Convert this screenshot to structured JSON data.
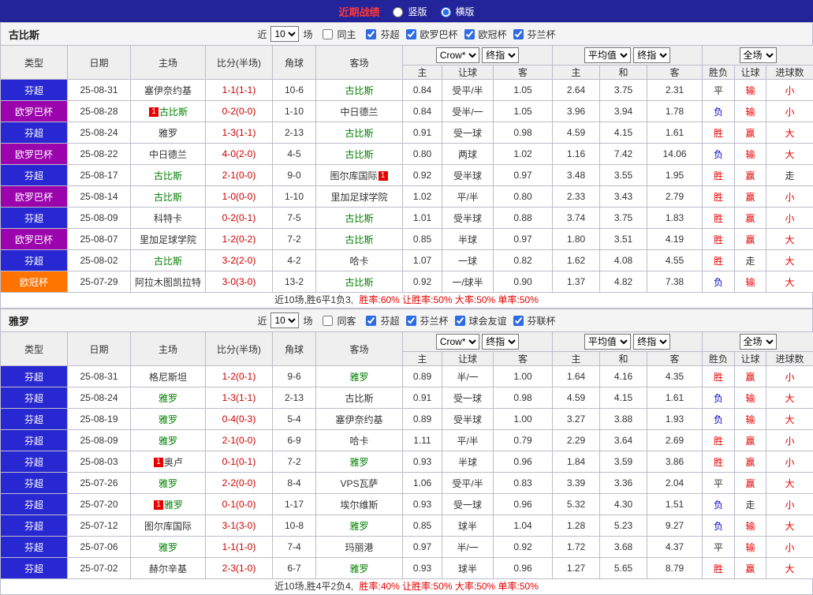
{
  "colors": {
    "topbar_bg": "#23239a",
    "title_red": "#ff3838",
    "league_blue": "#2828d2",
    "league_purple": "#9b03ac",
    "league_orange": "#ff7300",
    "focus_team_green": "#008000",
    "score_red": "#cc0000",
    "result_red": "#e60000",
    "result_blue": "#0000cc",
    "result_black": "#333333"
  },
  "top_bar": {
    "title": "近期战绩",
    "options": [
      {
        "label": "竖版",
        "selected": false
      },
      {
        "label": "横版",
        "selected": true
      }
    ]
  },
  "table_header": {
    "type": "类型",
    "date": "日期",
    "home": "主场",
    "score": "比分(半场)",
    "corner": "角球",
    "away": "客场",
    "crow_select": "Crow*",
    "final_select": "终指",
    "avg_select": "平均值",
    "fullmatch_select": "全场",
    "odds_home": "主",
    "odds_handicap": "让球",
    "odds_away": "客",
    "avg_home": "主",
    "avg_draw": "和",
    "avg_away": "客",
    "result_wdl": "胜负",
    "result_handicap": "让球",
    "result_goals": "进球数"
  },
  "sections": [
    {
      "team": "古比斯",
      "filters": {
        "near": "近",
        "count": "10",
        "games": "场",
        "same_side": "同主",
        "leagues": [
          "芬超",
          "欧罗巴杯",
          "欧冠杯",
          "芬兰杯"
        ]
      },
      "rows": [
        {
          "type": "芬超",
          "tc": "blue",
          "date": "25-08-31",
          "home": {
            "name": "塞伊奈约基",
            "focus": false
          },
          "score": "1-1(1-1)",
          "corner": "10-6",
          "away": {
            "name": "古比斯",
            "focus": true
          },
          "odds": [
            "0.84",
            "受平/半",
            "1.05"
          ],
          "avg": [
            "2.64",
            "3.75",
            "2.31"
          ],
          "res": [
            {
              "t": "平",
              "c": "black"
            },
            {
              "t": "输",
              "c": "red"
            },
            {
              "t": "小",
              "c": "red"
            }
          ]
        },
        {
          "type": "欧罗巴杯",
          "tc": "purple",
          "date": "25-08-28",
          "home": {
            "name": "古比斯",
            "focus": true,
            "badge_before": "1"
          },
          "score": "0-2(0-0)",
          "corner": "1-10",
          "away": {
            "name": "中日德兰",
            "focus": false
          },
          "odds": [
            "0.84",
            "受半/一",
            "1.05"
          ],
          "avg": [
            "3.96",
            "3.94",
            "1.78"
          ],
          "res": [
            {
              "t": "负",
              "c": "blue"
            },
            {
              "t": "输",
              "c": "red"
            },
            {
              "t": "小",
              "c": "red"
            }
          ]
        },
        {
          "type": "芬超",
          "tc": "blue",
          "date": "25-08-24",
          "home": {
            "name": "雅罗",
            "focus": false
          },
          "score": "1-3(1-1)",
          "corner": "2-13",
          "away": {
            "name": "古比斯",
            "focus": true
          },
          "odds": [
            "0.91",
            "受一球",
            "0.98"
          ],
          "avg": [
            "4.59",
            "4.15",
            "1.61"
          ],
          "res": [
            {
              "t": "胜",
              "c": "red"
            },
            {
              "t": "赢",
              "c": "red"
            },
            {
              "t": "大",
              "c": "red"
            }
          ]
        },
        {
          "type": "欧罗巴杯",
          "tc": "purple",
          "date": "25-08-22",
          "home": {
            "name": "中日德兰",
            "focus": false
          },
          "score": "4-0(2-0)",
          "corner": "4-5",
          "away": {
            "name": "古比斯",
            "focus": true
          },
          "odds": [
            "0.80",
            "两球",
            "1.02"
          ],
          "avg": [
            "1.16",
            "7.42",
            "14.06"
          ],
          "res": [
            {
              "t": "负",
              "c": "blue"
            },
            {
              "t": "输",
              "c": "red"
            },
            {
              "t": "大",
              "c": "red"
            }
          ]
        },
        {
          "type": "芬超",
          "tc": "blue",
          "date": "25-08-17",
          "home": {
            "name": "古比斯",
            "focus": true
          },
          "score": "2-1(0-0)",
          "corner": "9-0",
          "away": {
            "name": "图尔库国际",
            "focus": false,
            "badge_after": "1"
          },
          "odds": [
            "0.92",
            "受半球",
            "0.97"
          ],
          "avg": [
            "3.48",
            "3.55",
            "1.95"
          ],
          "res": [
            {
              "t": "胜",
              "c": "red"
            },
            {
              "t": "赢",
              "c": "red"
            },
            {
              "t": "走",
              "c": "black"
            }
          ]
        },
        {
          "type": "欧罗巴杯",
          "tc": "purple",
          "date": "25-08-14",
          "home": {
            "name": "古比斯",
            "focus": true
          },
          "score": "1-0(0-0)",
          "corner": "1-10",
          "away": {
            "name": "里加足球学院",
            "focus": false
          },
          "odds": [
            "1.02",
            "平/半",
            "0.80"
          ],
          "avg": [
            "2.33",
            "3.43",
            "2.79"
          ],
          "res": [
            {
              "t": "胜",
              "c": "red"
            },
            {
              "t": "赢",
              "c": "red"
            },
            {
              "t": "小",
              "c": "red"
            }
          ]
        },
        {
          "type": "芬超",
          "tc": "blue",
          "date": "25-08-09",
          "home": {
            "name": "科特卡",
            "focus": false
          },
          "score": "0-2(0-1)",
          "corner": "7-5",
          "away": {
            "name": "古比斯",
            "focus": true
          },
          "odds": [
            "1.01",
            "受半球",
            "0.88"
          ],
          "avg": [
            "3.74",
            "3.75",
            "1.83"
          ],
          "res": [
            {
              "t": "胜",
              "c": "red"
            },
            {
              "t": "赢",
              "c": "red"
            },
            {
              "t": "小",
              "c": "red"
            }
          ]
        },
        {
          "type": "欧罗巴杯",
          "tc": "purple",
          "date": "25-08-07",
          "home": {
            "name": "里加足球学院",
            "focus": false
          },
          "score": "1-2(0-2)",
          "corner": "7-2",
          "away": {
            "name": "古比斯",
            "focus": true
          },
          "odds": [
            "0.85",
            "半球",
            "0.97"
          ],
          "avg": [
            "1.80",
            "3.51",
            "4.19"
          ],
          "res": [
            {
              "t": "胜",
              "c": "red"
            },
            {
              "t": "赢",
              "c": "red"
            },
            {
              "t": "大",
              "c": "red"
            }
          ]
        },
        {
          "type": "芬超",
          "tc": "blue",
          "date": "25-08-02",
          "home": {
            "name": "古比斯",
            "focus": true
          },
          "score": "3-2(2-0)",
          "corner": "4-2",
          "away": {
            "name": "哈卡",
            "focus": false
          },
          "odds": [
            "1.07",
            "一球",
            "0.82"
          ],
          "avg": [
            "1.62",
            "4.08",
            "4.55"
          ],
          "res": [
            {
              "t": "胜",
              "c": "red"
            },
            {
              "t": "走",
              "c": "black"
            },
            {
              "t": "大",
              "c": "red"
            }
          ]
        },
        {
          "type": "欧冠杯",
          "tc": "orange",
          "date": "25-07-29",
          "home": {
            "name": "阿拉木图凯拉特",
            "focus": false
          },
          "score": "3-0(3-0)",
          "corner": "13-2",
          "away": {
            "name": "古比斯",
            "focus": true
          },
          "odds": [
            "0.92",
            "一/球半",
            "0.90"
          ],
          "avg": [
            "1.37",
            "4.82",
            "7.38"
          ],
          "res": [
            {
              "t": "负",
              "c": "blue"
            },
            {
              "t": "输",
              "c": "red"
            },
            {
              "t": "大",
              "c": "red"
            }
          ]
        }
      ],
      "summary": {
        "record": "近10场,胜6平1负3,",
        "rates": "胜率:60% 让胜率:50% 大率:50% 单率:50%"
      }
    },
    {
      "team": "雅罗",
      "filters": {
        "near": "近",
        "count": "10",
        "games": "场",
        "same_side": "同客",
        "leagues": [
          "芬超",
          "芬兰杯",
          "球会友谊",
          "芬联杯"
        ]
      },
      "rows": [
        {
          "type": "芬超",
          "tc": "blue",
          "date": "25-08-31",
          "home": {
            "name": "格尼斯坦",
            "focus": false
          },
          "score": "1-2(0-1)",
          "corner": "9-6",
          "away": {
            "name": "雅罗",
            "focus": true
          },
          "odds": [
            "0.89",
            "半/一",
            "1.00"
          ],
          "avg": [
            "1.64",
            "4.16",
            "4.35"
          ],
          "res": [
            {
              "t": "胜",
              "c": "red"
            },
            {
              "t": "赢",
              "c": "red"
            },
            {
              "t": "小",
              "c": "red"
            }
          ]
        },
        {
          "type": "芬超",
          "tc": "blue",
          "date": "25-08-24",
          "home": {
            "name": "雅罗",
            "focus": true
          },
          "score": "1-3(1-1)",
          "corner": "2-13",
          "away": {
            "name": "古比斯",
            "focus": false
          },
          "odds": [
            "0.91",
            "受一球",
            "0.98"
          ],
          "avg": [
            "4.59",
            "4.15",
            "1.61"
          ],
          "res": [
            {
              "t": "负",
              "c": "blue"
            },
            {
              "t": "输",
              "c": "red"
            },
            {
              "t": "大",
              "c": "red"
            }
          ]
        },
        {
          "type": "芬超",
          "tc": "blue",
          "date": "25-08-19",
          "home": {
            "name": "雅罗",
            "focus": true
          },
          "score": "0-4(0-3)",
          "corner": "5-4",
          "away": {
            "name": "塞伊奈约基",
            "focus": false
          },
          "odds": [
            "0.89",
            "受半球",
            "1.00"
          ],
          "avg": [
            "3.27",
            "3.88",
            "1.93"
          ],
          "res": [
            {
              "t": "负",
              "c": "blue"
            },
            {
              "t": "输",
              "c": "red"
            },
            {
              "t": "大",
              "c": "red"
            }
          ]
        },
        {
          "type": "芬超",
          "tc": "blue",
          "date": "25-08-09",
          "home": {
            "name": "雅罗",
            "focus": true
          },
          "score": "2-1(0-0)",
          "corner": "6-9",
          "away": {
            "name": "哈卡",
            "focus": false
          },
          "odds": [
            "1.11",
            "平/半",
            "0.79"
          ],
          "avg": [
            "2.29",
            "3.64",
            "2.69"
          ],
          "res": [
            {
              "t": "胜",
              "c": "red"
            },
            {
              "t": "赢",
              "c": "red"
            },
            {
              "t": "小",
              "c": "red"
            }
          ]
        },
        {
          "type": "芬超",
          "tc": "blue",
          "date": "25-08-03",
          "home": {
            "name": "奥卢",
            "focus": false,
            "badge_before": "1"
          },
          "score": "0-1(0-1)",
          "corner": "7-2",
          "away": {
            "name": "雅罗",
            "focus": true
          },
          "odds": [
            "0.93",
            "半球",
            "0.96"
          ],
          "avg": [
            "1.84",
            "3.59",
            "3.86"
          ],
          "res": [
            {
              "t": "胜",
              "c": "red"
            },
            {
              "t": "赢",
              "c": "red"
            },
            {
              "t": "小",
              "c": "red"
            }
          ]
        },
        {
          "type": "芬超",
          "tc": "blue",
          "date": "25-07-26",
          "home": {
            "name": "雅罗",
            "focus": true
          },
          "score": "2-2(0-0)",
          "corner": "8-4",
          "away": {
            "name": "VPS瓦萨",
            "focus": false
          },
          "odds": [
            "1.06",
            "受平/半",
            "0.83"
          ],
          "avg": [
            "3.39",
            "3.36",
            "2.04"
          ],
          "res": [
            {
              "t": "平",
              "c": "black"
            },
            {
              "t": "赢",
              "c": "red"
            },
            {
              "t": "大",
              "c": "red"
            }
          ]
        },
        {
          "type": "芬超",
          "tc": "blue",
          "date": "25-07-20",
          "home": {
            "name": "雅罗",
            "focus": true,
            "badge_before": "1"
          },
          "score": "0-1(0-0)",
          "corner": "1-17",
          "away": {
            "name": "埃尔维斯",
            "focus": false
          },
          "odds": [
            "0.93",
            "受一球",
            "0.96"
          ],
          "avg": [
            "5.32",
            "4.30",
            "1.51"
          ],
          "res": [
            {
              "t": "负",
              "c": "blue"
            },
            {
              "t": "走",
              "c": "black"
            },
            {
              "t": "小",
              "c": "red"
            }
          ]
        },
        {
          "type": "芬超",
          "tc": "blue",
          "date": "25-07-12",
          "home": {
            "name": "图尔库国际",
            "focus": false
          },
          "score": "3-1(3-0)",
          "corner": "10-8",
          "away": {
            "name": "雅罗",
            "focus": true
          },
          "odds": [
            "0.85",
            "球半",
            "1.04"
          ],
          "avg": [
            "1.28",
            "5.23",
            "9.27"
          ],
          "res": [
            {
              "t": "负",
              "c": "blue"
            },
            {
              "t": "输",
              "c": "red"
            },
            {
              "t": "大",
              "c": "red"
            }
          ]
        },
        {
          "type": "芬超",
          "tc": "blue",
          "date": "25-07-06",
          "home": {
            "name": "雅罗",
            "focus": true
          },
          "score": "1-1(1-0)",
          "corner": "7-4",
          "away": {
            "name": "玛丽港",
            "focus": false
          },
          "odds": [
            "0.97",
            "半/一",
            "0.92"
          ],
          "avg": [
            "1.72",
            "3.68",
            "4.37"
          ],
          "res": [
            {
              "t": "平",
              "c": "black"
            },
            {
              "t": "输",
              "c": "red"
            },
            {
              "t": "小",
              "c": "red"
            }
          ]
        },
        {
          "type": "芬超",
          "tc": "blue",
          "date": "25-07-02",
          "home": {
            "name": "赫尔辛基",
            "focus": false
          },
          "score": "2-3(1-0)",
          "corner": "6-7",
          "away": {
            "name": "雅罗",
            "focus": true
          },
          "odds": [
            "0.93",
            "球半",
            "0.96"
          ],
          "avg": [
            "1.27",
            "5.65",
            "8.79"
          ],
          "res": [
            {
              "t": "胜",
              "c": "red"
            },
            {
              "t": "赢",
              "c": "red"
            },
            {
              "t": "大",
              "c": "red"
            }
          ]
        }
      ],
      "summary": {
        "record": "近10场,胜4平2负4,",
        "rates": "胜率:40% 让胜率:50% 大率:50% 单率:50%"
      }
    }
  ]
}
